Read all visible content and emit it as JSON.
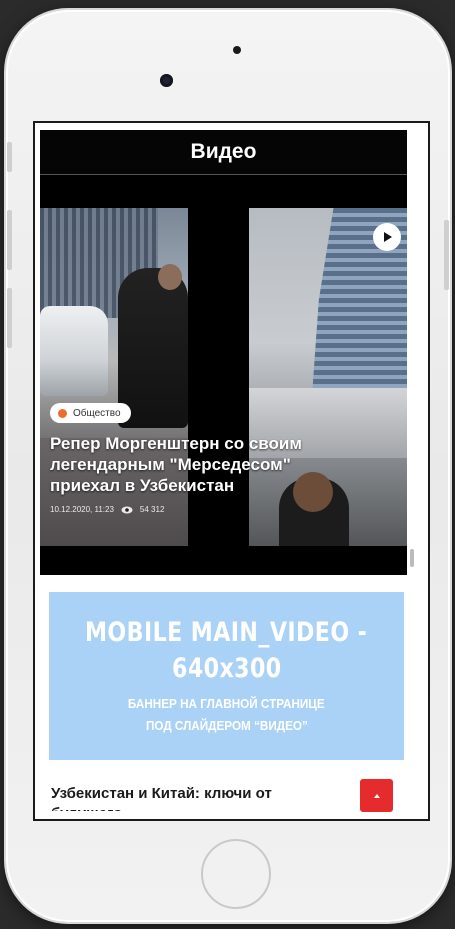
{
  "header": {
    "title": "Видео"
  },
  "slider": {
    "category": "Общество",
    "category_color": "#ee6a2f",
    "title": "Репер Моргенштерн со своим легендарным \"Мерседесом\" приехал в Узбекистан",
    "date": "10.12.2020, 11:23",
    "views": "54 312",
    "play_icon": "play-icon",
    "views_icon": "eye-icon"
  },
  "banner": {
    "title_line1": "MOBILE MAIN_VIDEO -",
    "title_line2": "640x300",
    "sub_line1": "БАННЕР НА ГЛАВНОЙ СТРАНИЦЕ",
    "sub_line2": "ПОД СЛАЙДЕРОМ “ВИДЕО”",
    "background": "#aad2f6"
  },
  "news": {
    "title": "Узбекистан и Китай: ключи от будущего"
  },
  "scroll_top": {
    "icon": "chevron-up-icon",
    "color": "#e52b2b"
  }
}
